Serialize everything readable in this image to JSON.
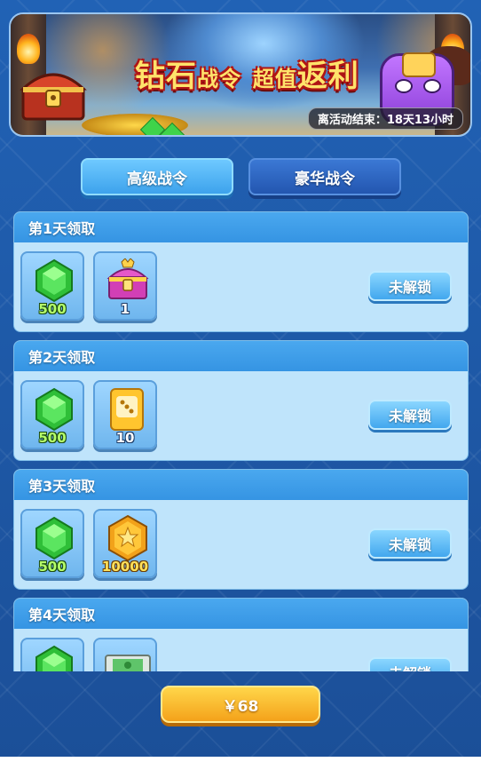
{
  "banner": {
    "title_part1": "钻石",
    "title_part2": "战令",
    "title_part3": "超值",
    "title_part4": "返利",
    "timer": "离活动结束：18天13小时"
  },
  "tabs": [
    {
      "label": "高级战令",
      "active": true
    },
    {
      "label": "豪华战令",
      "active": false
    }
  ],
  "rewards": [
    {
      "day_label": "第1天领取",
      "items": [
        {
          "icon": "green-gem-icon",
          "qty": "500"
        },
        {
          "icon": "treasure-chest-icon",
          "qty": "1"
        }
      ],
      "status": "未解锁"
    },
    {
      "day_label": "第2天领取",
      "items": [
        {
          "icon": "gem-icon",
          "qty": "500"
        },
        {
          "icon": "dice-card-icon",
          "qty": "10"
        }
      ],
      "status": "未解锁"
    },
    {
      "day_label": "第3天领取",
      "items": [
        {
          "icon": "gem-icon",
          "qty": "500"
        },
        {
          "icon": "gold-coin-icon",
          "qty": "10000"
        }
      ],
      "status": "未解锁"
    },
    {
      "day_label": "第4天领取",
      "items": [
        {
          "icon": "gem-icon",
          "qty": ""
        },
        {
          "icon": "ticket-icon",
          "qty": ""
        }
      ],
      "status": "未解锁"
    }
  ],
  "purchase": {
    "price_label": "￥68"
  },
  "colors": {
    "gem": "#3fd34a",
    "accent_blue": "#3da2ec",
    "buy_gold": "#f4a21a"
  }
}
